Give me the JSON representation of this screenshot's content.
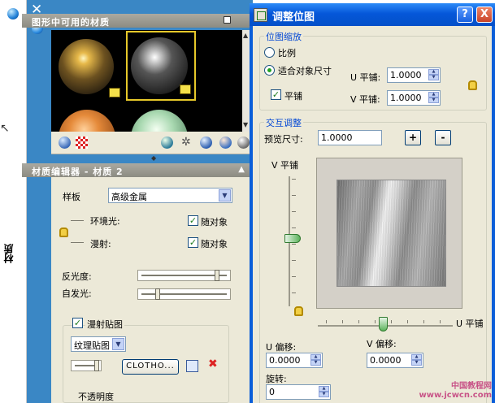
{
  "palette_strip": {
    "vertical_title": "材质"
  },
  "materials_palette": {
    "available_header": "图形中可用的材质",
    "editor_header": "材质编辑器 - 材质 2",
    "editor": {
      "template_label": "样板",
      "template_value": "高级金属",
      "ambient_label": "环境光:",
      "ambient_check_label": "随对象",
      "diffuse_label": "漫射:",
      "diffuse_check_label": "随对象",
      "reflectivity_label": "反光度:",
      "reflectivity_value": 0.88,
      "self_illum_label": "自发光:",
      "self_illum_value": 0.2,
      "diffuse_map_check_label": "漫射贴图",
      "map_type_value": "纹理贴图",
      "map_file_button": "CLOTHO...",
      "opacity_label": "不透明度"
    }
  },
  "dialog": {
    "title": "调整位图",
    "help_label": "?",
    "close_label": "X",
    "bitmap_scale_title": "位图缩放",
    "radio_ratio": "比例",
    "radio_fit": "适合对象尺寸",
    "u_tile_label": "U 平铺:",
    "u_tile_value": "1.0000",
    "v_tile_label": "V 平铺:",
    "v_tile_value": "1.0000",
    "tile_check_label": "平铺",
    "interactive_title": "交互调整",
    "preview_size_label": "预览尺寸:",
    "preview_size_value": "1.0000",
    "plus_label": "+",
    "minus_label": "-",
    "v_axis_label": "V 平铺",
    "u_axis_label": "U 平铺",
    "u_offset_label": "U 偏移:",
    "u_offset_value": "0.0000",
    "v_offset_label": "V 偏移:",
    "v_offset_value": "0.0000",
    "rotation_label": "旋转:",
    "rotation_value": "0"
  },
  "watermark": {
    "line1": "中国教程网",
    "line2": "www.jcwcn.com"
  },
  "colors": {
    "palette_blue": "#3a87c5",
    "dialog_title_blue": "#0557d9",
    "panel_face": "#ece9d8",
    "section_title": "#0046d5"
  }
}
